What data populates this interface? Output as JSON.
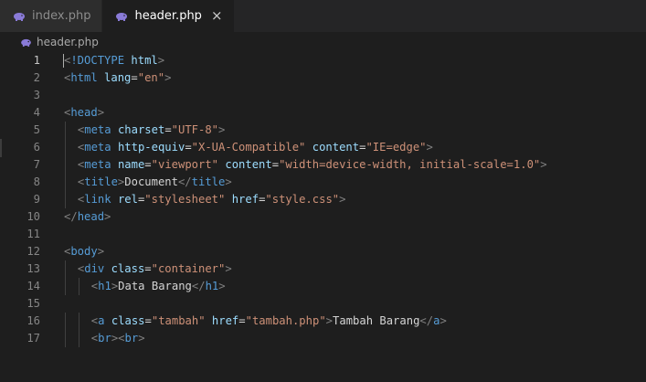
{
  "tabs": [
    {
      "label": "index.php",
      "active": false,
      "icon": "php-elephant-icon"
    },
    {
      "label": "header.php",
      "active": true,
      "icon": "php-elephant-icon",
      "close_glyph": "×"
    }
  ],
  "breadcrumb": {
    "file": "header.php",
    "icon": "php-elephant-icon"
  },
  "colors": {
    "background": "#1e1e1e",
    "tag": "#569cd6",
    "punctuation": "#808080",
    "attribute": "#9cdcfe",
    "string": "#ce9178",
    "text": "#d4d4d4",
    "php_icon": "#8a7bd8"
  },
  "current_line": 1,
  "lines": [
    {
      "n": "1",
      "indent": 0,
      "tokens": [
        [
          "p",
          "<"
        ],
        [
          "t",
          "!DOCTYPE"
        ],
        [
          "x",
          " "
        ],
        [
          "a",
          "html"
        ],
        [
          "p",
          ">"
        ]
      ]
    },
    {
      "n": "2",
      "indent": 0,
      "tokens": [
        [
          "p",
          "<"
        ],
        [
          "t",
          "html"
        ],
        [
          "x",
          " "
        ],
        [
          "a",
          "lang"
        ],
        [
          "x",
          "="
        ],
        [
          "s",
          "\"en\""
        ],
        [
          "p",
          ">"
        ]
      ]
    },
    {
      "n": "3",
      "indent": 0,
      "tokens": []
    },
    {
      "n": "4",
      "indent": 0,
      "tokens": [
        [
          "p",
          "<"
        ],
        [
          "t",
          "head"
        ],
        [
          "p",
          ">"
        ]
      ]
    },
    {
      "n": "5",
      "indent": 1,
      "tokens": [
        [
          "p",
          "<"
        ],
        [
          "t",
          "meta"
        ],
        [
          "x",
          " "
        ],
        [
          "a",
          "charset"
        ],
        [
          "x",
          "="
        ],
        [
          "s",
          "\"UTF-8\""
        ],
        [
          "p",
          ">"
        ]
      ]
    },
    {
      "n": "6",
      "indent": 1,
      "tokens": [
        [
          "p",
          "<"
        ],
        [
          "t",
          "meta"
        ],
        [
          "x",
          " "
        ],
        [
          "a",
          "http-equiv"
        ],
        [
          "x",
          "="
        ],
        [
          "s",
          "\"X-UA-Compatible\""
        ],
        [
          "x",
          " "
        ],
        [
          "a",
          "content"
        ],
        [
          "x",
          "="
        ],
        [
          "s",
          "\"IE=edge\""
        ],
        [
          "p",
          ">"
        ]
      ]
    },
    {
      "n": "7",
      "indent": 1,
      "tokens": [
        [
          "p",
          "<"
        ],
        [
          "t",
          "meta"
        ],
        [
          "x",
          " "
        ],
        [
          "a",
          "name"
        ],
        [
          "x",
          "="
        ],
        [
          "s",
          "\"viewport\""
        ],
        [
          "x",
          " "
        ],
        [
          "a",
          "content"
        ],
        [
          "x",
          "="
        ],
        [
          "s",
          "\"width=device-width, initial-scale=1.0\""
        ],
        [
          "p",
          ">"
        ]
      ]
    },
    {
      "n": "8",
      "indent": 1,
      "tokens": [
        [
          "p",
          "<"
        ],
        [
          "t",
          "title"
        ],
        [
          "p",
          ">"
        ],
        [
          "x",
          "Document"
        ],
        [
          "p",
          "</"
        ],
        [
          "t",
          "title"
        ],
        [
          "p",
          ">"
        ]
      ]
    },
    {
      "n": "9",
      "indent": 1,
      "tokens": [
        [
          "p",
          "<"
        ],
        [
          "t",
          "link"
        ],
        [
          "x",
          " "
        ],
        [
          "a",
          "rel"
        ],
        [
          "x",
          "="
        ],
        [
          "s",
          "\"stylesheet\""
        ],
        [
          "x",
          " "
        ],
        [
          "a",
          "href"
        ],
        [
          "x",
          "="
        ],
        [
          "s",
          "\"style.css\""
        ],
        [
          "p",
          ">"
        ]
      ]
    },
    {
      "n": "10",
      "indent": 0,
      "tokens": [
        [
          "p",
          "</"
        ],
        [
          "t",
          "head"
        ],
        [
          "p",
          ">"
        ]
      ]
    },
    {
      "n": "11",
      "indent": 0,
      "tokens": []
    },
    {
      "n": "12",
      "indent": 0,
      "tokens": [
        [
          "p",
          "<"
        ],
        [
          "t",
          "body"
        ],
        [
          "p",
          ">"
        ]
      ]
    },
    {
      "n": "13",
      "indent": 1,
      "tokens": [
        [
          "p",
          "<"
        ],
        [
          "t",
          "div"
        ],
        [
          "x",
          " "
        ],
        [
          "a",
          "class"
        ],
        [
          "x",
          "="
        ],
        [
          "s",
          "\"container\""
        ],
        [
          "p",
          ">"
        ]
      ]
    },
    {
      "n": "14",
      "indent": 2,
      "tokens": [
        [
          "p",
          "<"
        ],
        [
          "t",
          "h1"
        ],
        [
          "p",
          ">"
        ],
        [
          "x",
          "Data Barang"
        ],
        [
          "p",
          "</"
        ],
        [
          "t",
          "h1"
        ],
        [
          "p",
          ">"
        ]
      ]
    },
    {
      "n": "15",
      "indent": 0,
      "tokens": []
    },
    {
      "n": "16",
      "indent": 2,
      "tokens": [
        [
          "p",
          "<"
        ],
        [
          "t",
          "a"
        ],
        [
          "x",
          " "
        ],
        [
          "a",
          "class"
        ],
        [
          "x",
          "="
        ],
        [
          "s",
          "\"tambah\""
        ],
        [
          "x",
          " "
        ],
        [
          "a",
          "href"
        ],
        [
          "x",
          "="
        ],
        [
          "s",
          "\"tambah.php\""
        ],
        [
          "p",
          ">"
        ],
        [
          "x",
          "Tambah Barang"
        ],
        [
          "p",
          "</"
        ],
        [
          "t",
          "a"
        ],
        [
          "p",
          ">"
        ]
      ]
    },
    {
      "n": "17",
      "indent": 2,
      "tokens": [
        [
          "p",
          "<"
        ],
        [
          "t",
          "br"
        ],
        [
          "p",
          ">"
        ],
        [
          "p",
          "<"
        ],
        [
          "t",
          "br"
        ],
        [
          "p",
          ">"
        ]
      ]
    }
  ]
}
